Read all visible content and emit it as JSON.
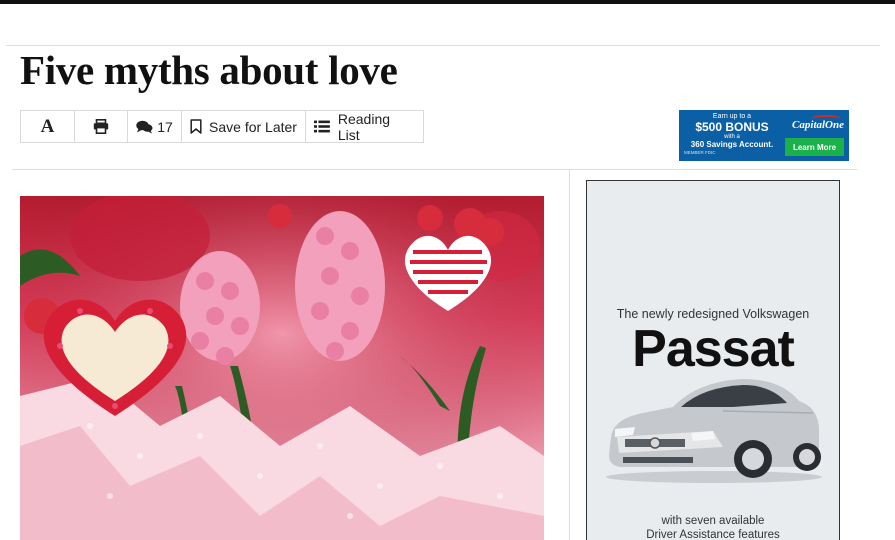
{
  "article": {
    "headline": "Five myths about love"
  },
  "toolbar": {
    "font_label": "A",
    "comments_count": "17",
    "save_label": "Save for Later",
    "reading_list_label": "Reading List"
  },
  "ad_banner": {
    "line1": "Earn up to a",
    "line2": "$500 BONUS",
    "line3": "with a",
    "line4": "360 Savings Account.",
    "line5": "MEMBER FDIC",
    "brand": "CapitalOne",
    "cta": "Learn More"
  },
  "ad_side": {
    "pretitle": "The newly redesigned Volkswagen",
    "model": "Passat",
    "foot_line1": "with seven available",
    "foot_line2": "Driver Assistance features"
  },
  "icons": {
    "font": "font-size-icon",
    "print": "printer-icon",
    "comments": "comments-icon",
    "save": "bookmark-icon",
    "list": "list-icon"
  },
  "colors": {
    "banner_bg": "#0b5fa5",
    "banner_cta": "#1ab14b",
    "brand_red": "#d22e1e"
  }
}
